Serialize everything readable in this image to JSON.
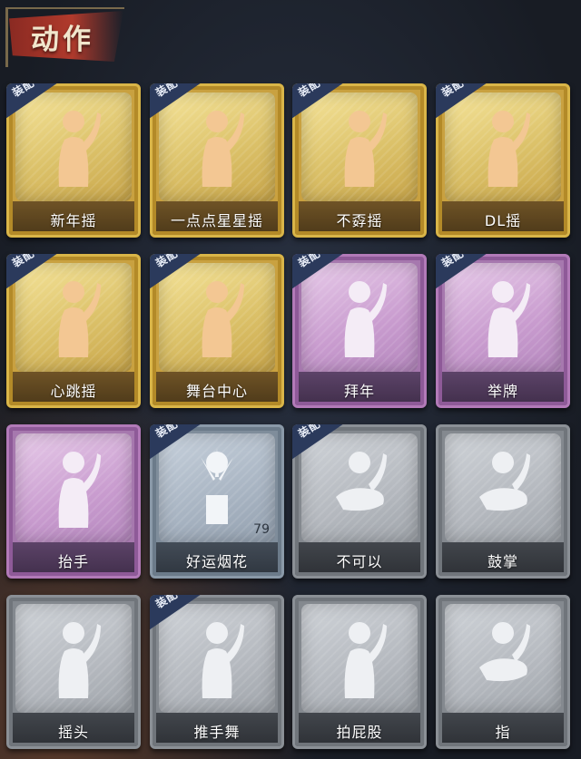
{
  "header": {
    "title": "动作"
  },
  "badge_text": "装配",
  "cards": [
    {
      "label": "新年摇",
      "rarity": "gold",
      "equipped": true,
      "icon": "figure-shake-icon"
    },
    {
      "label": "一点点星星摇",
      "rarity": "gold",
      "equipped": true,
      "icon": "figure-star-icon"
    },
    {
      "label": "不孬摇",
      "rarity": "gold",
      "equipped": true,
      "icon": "figure-raise-arm-icon"
    },
    {
      "label": "DL摇",
      "rarity": "gold",
      "equipped": true,
      "icon": "figure-dance-icon"
    },
    {
      "label": "心跳摇",
      "rarity": "gold",
      "equipped": true,
      "icon": "figure-heartbeat-icon"
    },
    {
      "label": "舞台中心",
      "rarity": "gold",
      "equipped": true,
      "icon": "figure-stage-icon"
    },
    {
      "label": "拜年",
      "rarity": "purple",
      "equipped": true,
      "icon": "figure-bow-icon"
    },
    {
      "label": "举牌",
      "rarity": "purple",
      "equipped": true,
      "icon": "figure-sign-icon"
    },
    {
      "label": "抬手",
      "rarity": "purple",
      "equipped": false,
      "icon": "figure-lift-hand-icon"
    },
    {
      "label": "好运烟花",
      "rarity": "blue",
      "equipped": true,
      "icon": "firework-icon",
      "count": "79"
    },
    {
      "label": "不可以",
      "rarity": "gray",
      "equipped": true,
      "icon": "finger-wag-icon"
    },
    {
      "label": "鼓掌",
      "rarity": "gray",
      "equipped": false,
      "icon": "clap-icon"
    },
    {
      "label": "摇头",
      "rarity": "gray",
      "equipped": false,
      "icon": "figure-head-shake-icon"
    },
    {
      "label": "推手舞",
      "rarity": "gray",
      "equipped": true,
      "icon": "figure-push-dance-icon"
    },
    {
      "label": "拍屁股",
      "rarity": "gray",
      "equipped": false,
      "icon": "figure-pat-icon"
    },
    {
      "label": "指",
      "rarity": "gray",
      "equipped": false,
      "icon": "pointing-hand-icon"
    }
  ]
}
